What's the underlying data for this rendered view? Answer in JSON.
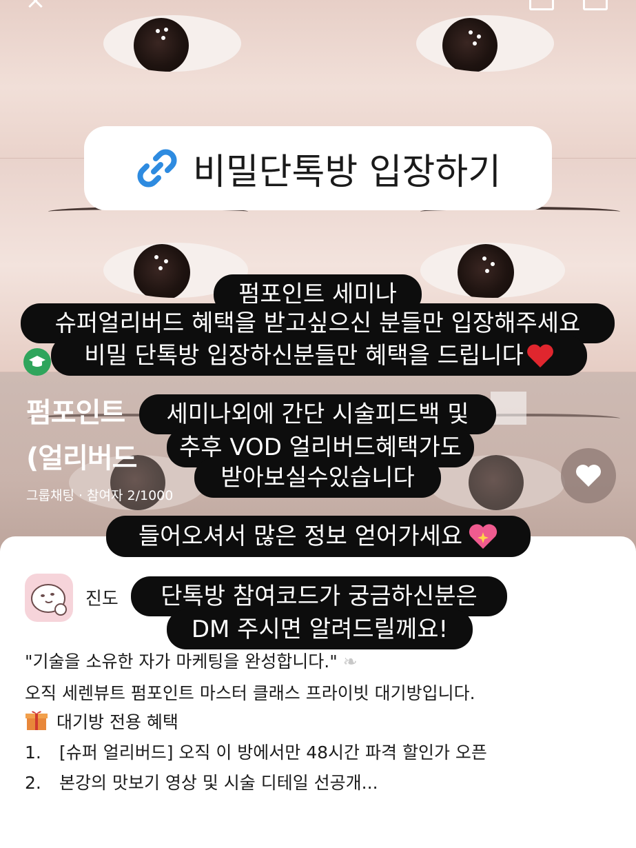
{
  "link_title": "비밀단톡방 입장하기",
  "room": {
    "title_line1": "펌포인트",
    "title_line2": "(얼리버드",
    "meta": "그룹채팅 · 참여자 2/1000"
  },
  "host": {
    "name": "진도"
  },
  "description": {
    "quote": "\"기술을 소유한 자가 마케팅을 완성합니다.\"",
    "intro": "오직 세렌뷰트 펌포인트 마스터 클래스 프라이빗 대기방입니다.",
    "benefit_header": "대기방 전용 혜택",
    "items": [
      {
        "num": "1.",
        "text": "[슈퍼 얼리버드] 오직 이 방에서만 48시간 파격 할인가 오픈"
      },
      {
        "num": "2.",
        "text": "본강의 맛보기 영상 및 시술 디테일 선공개..."
      }
    ]
  },
  "stickers": {
    "s1": "펌포인트 세미나",
    "s2": "슈퍼얼리버드 혜택을 받고싶으신 분들만 입장해주세요",
    "s3": "비밀 단톡방 입장하신분들만 혜택을 드립니다",
    "s4": "세미나외에 간단 시술피드백 및",
    "s5": "추후 VOD 얼리버드혜택가도",
    "s6": "받아보실수있습니다",
    "s7": "들어오셔서 많은 정보 얻어가세요",
    "s8": "단톡방 참여코드가 궁금하신분은",
    "s9": "DM 주시면 알려드릴께요!"
  },
  "colors": {
    "sticker_bg": "#0d0d0d",
    "link_blue": "#2e8be0",
    "accent_green": "#2fa55c"
  }
}
